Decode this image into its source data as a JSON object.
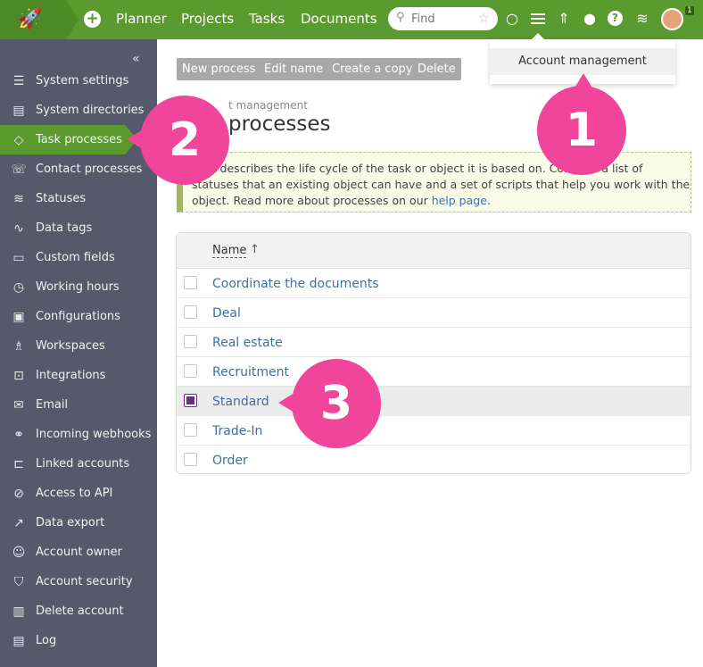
{
  "topbar": {
    "logo_icon": "rocket-icon",
    "nav": [
      "Planner",
      "Projects",
      "Tasks",
      "Documents"
    ],
    "search_placeholder": "Find",
    "avatar_badge": "1"
  },
  "dropdown": {
    "item": "Account management"
  },
  "sidebar": {
    "collapse_glyph": "«",
    "items": [
      {
        "label": "System settings",
        "icon": "sliders-icon"
      },
      {
        "label": "System directories",
        "icon": "directory-icon"
      },
      {
        "label": "Task processes",
        "icon": "process-icon"
      },
      {
        "label": "Contact processes",
        "icon": "contact-process-icon"
      },
      {
        "label": "Statuses",
        "icon": "statuses-icon"
      },
      {
        "label": "Data tags",
        "icon": "tag-icon"
      },
      {
        "label": "Custom fields",
        "icon": "fields-icon"
      },
      {
        "label": "Working hours",
        "icon": "clock-icon"
      },
      {
        "label": "Configurations",
        "icon": "calendar-check-icon"
      },
      {
        "label": "Workspaces",
        "icon": "rocket-icon"
      },
      {
        "label": "Integrations",
        "icon": "puzzle-icon"
      },
      {
        "label": "Email",
        "icon": "mail-icon"
      },
      {
        "label": "Incoming webhooks",
        "icon": "webhook-icon"
      },
      {
        "label": "Linked accounts",
        "icon": "link-icon"
      },
      {
        "label": "Access to API",
        "icon": "api-icon"
      },
      {
        "label": "Data export",
        "icon": "export-icon"
      },
      {
        "label": "Account owner",
        "icon": "user-icon"
      },
      {
        "label": "Account security",
        "icon": "shield-icon"
      },
      {
        "label": "Delete account",
        "icon": "trash-icon"
      },
      {
        "label": "Log",
        "icon": "log-icon"
      }
    ]
  },
  "toolbar": {
    "new_process": "New process",
    "edit_name": "Edit name",
    "create_copy": "Create a copy",
    "delete": "Delete"
  },
  "page": {
    "breadcrumb": "t management",
    "title": "processes",
    "info_text": "cess describes the life cycle of the task or object it is based on. Contains a list of statuses that an existing object can have and a set of scripts that help you work with the object. Read more about processes on our ",
    "info_link": "help page",
    "info_end": "."
  },
  "table": {
    "header_name": "Name",
    "sort_glyph": "↑",
    "rows": [
      "Coordinate the documents",
      "Deal",
      "Real estate",
      "Recruitment",
      "Standard",
      "Trade-In",
      "Order"
    ],
    "selected_row": "Standard"
  },
  "callouts": [
    "1",
    "2",
    "3"
  ],
  "colors": {
    "brand_green": "#5b9a2e",
    "sidebar": "#545a6b",
    "callout": "#f0459b",
    "link": "#3e6fa8"
  }
}
